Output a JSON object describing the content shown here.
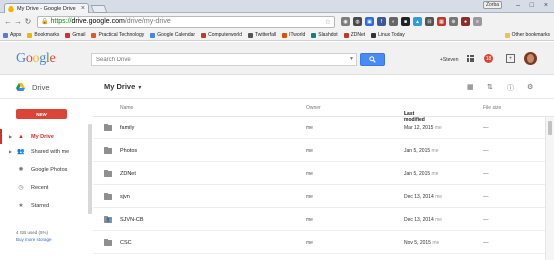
{
  "browser": {
    "tab_title": "My Drive - Google Drive",
    "profile": "Zorba",
    "url_scheme": "https://",
    "url_host": "drive.google.com",
    "url_path": "/drive/my-drive",
    "bookmarks": [
      {
        "label": "Apps",
        "color": "#5b7bd5"
      },
      {
        "label": "Bookmarks",
        "color": "#f4b400"
      },
      {
        "label": "Gmail",
        "color": "#d93025"
      },
      {
        "label": "Practical Technology",
        "color": "#e0592a"
      },
      {
        "label": "Google Calendar",
        "color": "#4285f4"
      },
      {
        "label": "Computerworld",
        "color": "#c0392b"
      },
      {
        "label": "Twitterfall",
        "color": "#555555"
      },
      {
        "label": "ITworld",
        "color": "#d35400"
      },
      {
        "label": "Slashdot",
        "color": "#1a7d7d"
      },
      {
        "label": "ZDNet",
        "color": "#c0392b"
      },
      {
        "label": "Linux Today",
        "color": "#333333"
      }
    ],
    "other_bookmarks": "Other bookmarks"
  },
  "header": {
    "logo_letters": [
      {
        "ch": "G",
        "color": "#4285f4"
      },
      {
        "ch": "o",
        "color": "#ea4335"
      },
      {
        "ch": "o",
        "color": "#fbbc05"
      },
      {
        "ch": "g",
        "color": "#4285f4"
      },
      {
        "ch": "l",
        "color": "#34a853"
      },
      {
        "ch": "e",
        "color": "#ea4335"
      }
    ],
    "search_placeholder": "Search Drive",
    "user": "+Steven",
    "notification_count": "18"
  },
  "drivebar": {
    "app_name": "Drive",
    "location": "My Drive"
  },
  "sidebar": {
    "new_label": "NEW",
    "items": [
      {
        "label": "My Drive",
        "icon": "drive-icon"
      },
      {
        "label": "Shared with me",
        "icon": "people-icon"
      },
      {
        "label": "Google Photos",
        "icon": "photos-icon"
      },
      {
        "label": "Recent",
        "icon": "clock-icon"
      },
      {
        "label": "Starred",
        "icon": "star-icon"
      }
    ],
    "storage": "4 GB used (5%)",
    "buy_storage": "Buy more storage"
  },
  "columns": {
    "name": "Name",
    "owner": "Owner",
    "modified": "Last modified",
    "size": "File size"
  },
  "files": [
    {
      "name": "family",
      "owner": "me",
      "modified": "Mar 12, 2015",
      "by": "me",
      "size": "—",
      "shared": false
    },
    {
      "name": "Photos",
      "owner": "me",
      "modified": "Jan 5, 2015",
      "by": "me",
      "size": "—",
      "shared": false
    },
    {
      "name": "ZDNet",
      "owner": "me",
      "modified": "Jan 5, 2015",
      "by": "me",
      "size": "—",
      "shared": false
    },
    {
      "name": "sjvn",
      "owner": "me",
      "modified": "Dec 13, 2014",
      "by": "me",
      "size": "—",
      "shared": false
    },
    {
      "name": "SJVN-CB",
      "owner": "me",
      "modified": "Dec 13, 2014",
      "by": "me",
      "size": "—",
      "shared": true
    },
    {
      "name": "CSC",
      "owner": "me",
      "modified": "Nov 5, 2015",
      "by": "me",
      "size": "—",
      "shared": false
    }
  ]
}
